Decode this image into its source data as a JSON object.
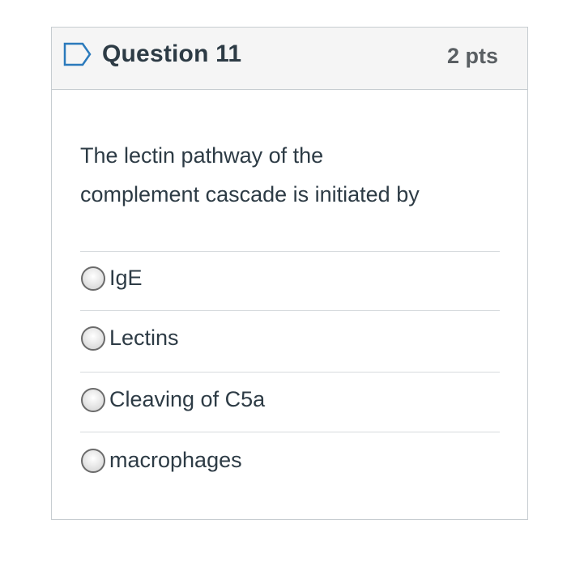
{
  "question": {
    "title": "Question 11",
    "points": "2 pts",
    "text_line1": "The lectin pathway of the",
    "text_line2": "complement cascade is initiated by",
    "flag_icon": "flag-bookmark-icon"
  },
  "answers": [
    {
      "label": "IgE",
      "selected": false
    },
    {
      "label": "Lectins",
      "selected": false
    },
    {
      "label": "Cleaving of C5a",
      "selected": false
    },
    {
      "label": "macrophages",
      "selected": false
    }
  ],
  "colors": {
    "header_bg": "#f5f5f5",
    "border": "#c7cdd1",
    "text": "#2d3b45",
    "flag": "#2b7abc"
  }
}
